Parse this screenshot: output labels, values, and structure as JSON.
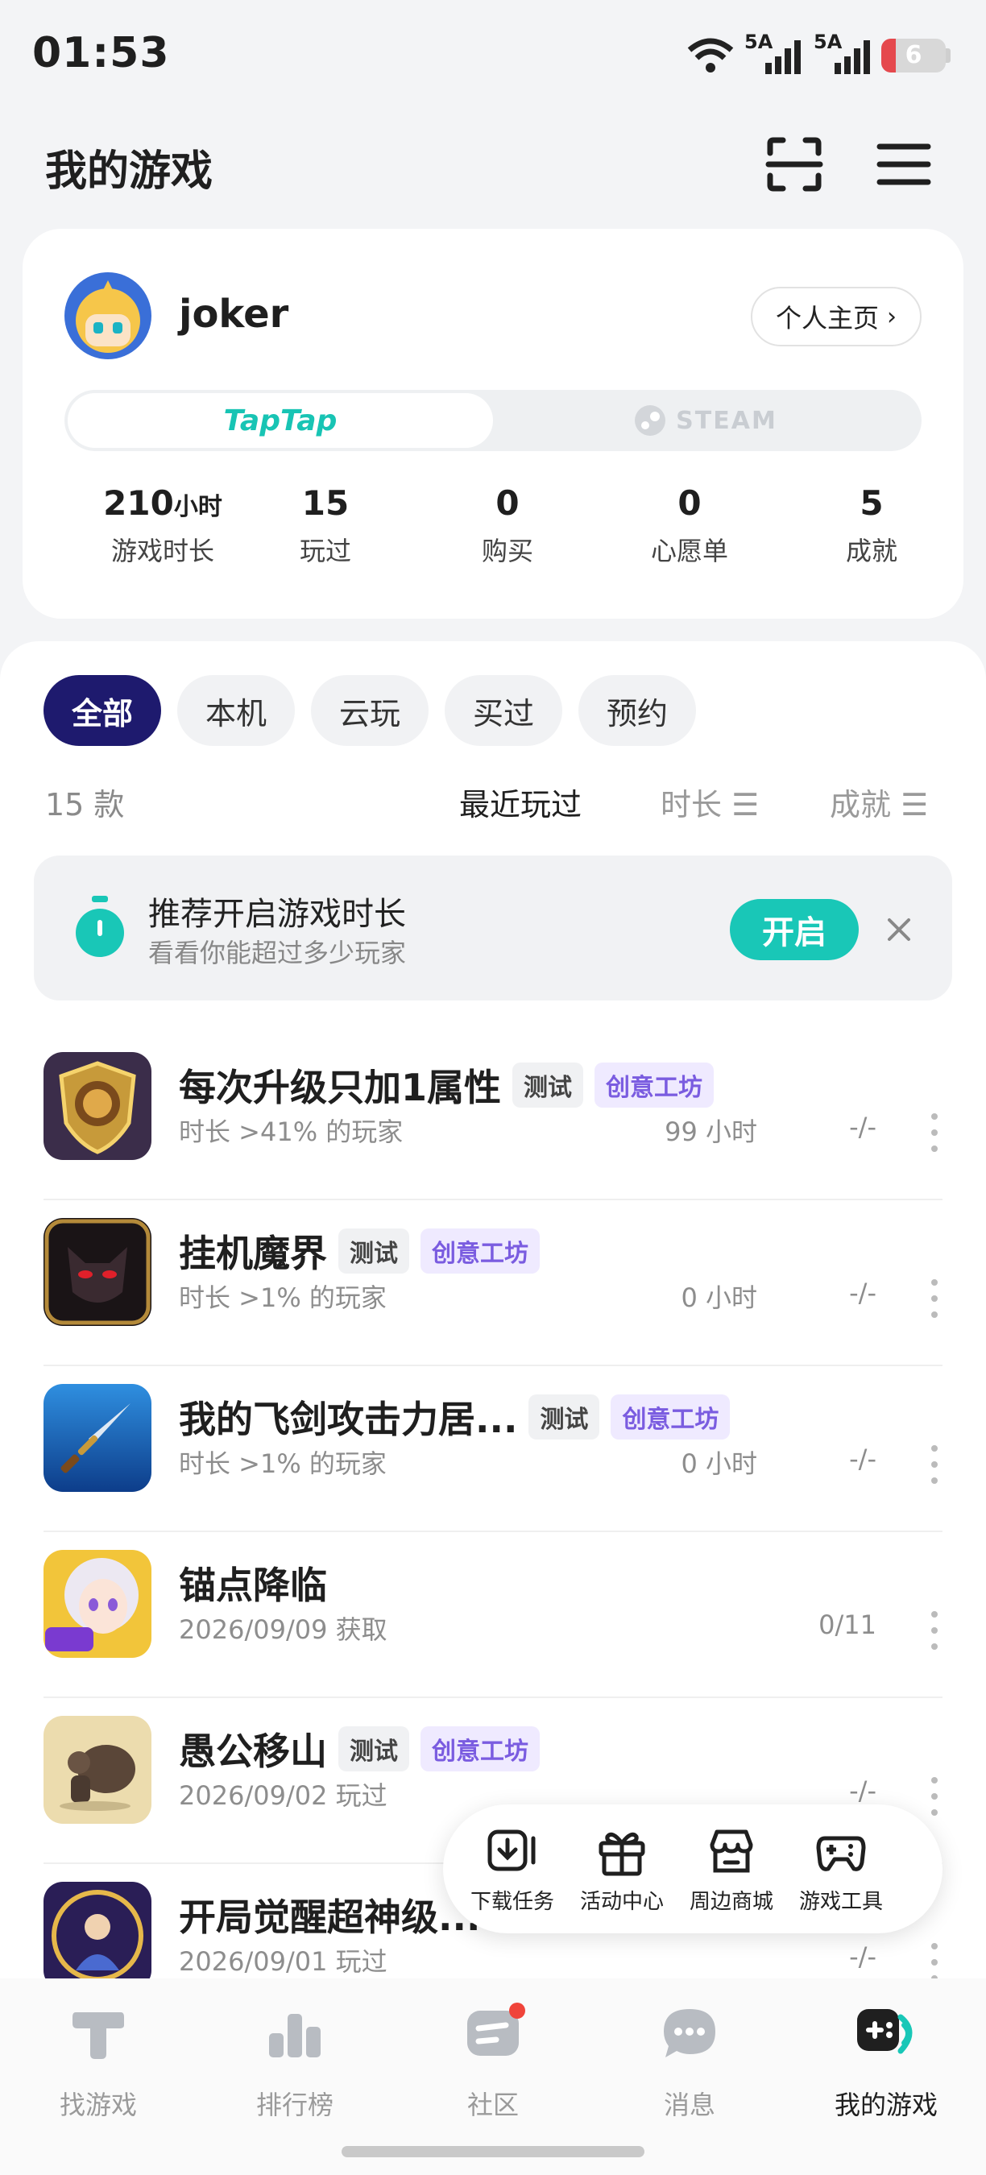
{
  "status_bar": {
    "time": "01:53",
    "sim1": "5A",
    "sim2": "5A",
    "battery": "6"
  },
  "header": {
    "title": "我的游戏",
    "scan_icon": "scan-icon",
    "menu_icon": "menu-icon"
  },
  "profile": {
    "username": "joker",
    "homepage_label": "个人主页",
    "platforms": {
      "taptap": "TapTap",
      "steam": "STEAM",
      "active": "taptap"
    },
    "stats": [
      {
        "value": "210",
        "unit": "小时",
        "label": "游戏时长"
      },
      {
        "value": "15",
        "unit": "",
        "label": "玩过"
      },
      {
        "value": "0",
        "unit": "",
        "label": "购买"
      },
      {
        "value": "0",
        "unit": "",
        "label": "心愿单"
      },
      {
        "value": "5",
        "unit": "",
        "label": "成就"
      }
    ]
  },
  "filters": {
    "items": [
      "全部",
      "本机",
      "云玩",
      "买过",
      "预约"
    ],
    "active": "全部"
  },
  "list_meta": {
    "count": "15 款",
    "sorts": [
      {
        "label": "最近玩过",
        "active": true
      },
      {
        "label": "时长 ☰",
        "active": false
      },
      {
        "label": "成就 ☰",
        "active": false
      }
    ]
  },
  "banner": {
    "title": "推荐开启游戏时长",
    "subtitle": "看看你能超过多少玩家",
    "button": "开启"
  },
  "games": [
    {
      "name": "每次升级只加1属性",
      "tags": [
        "测试",
        "创意工坊"
      ],
      "sub": "时长 >41% 的玩家",
      "hours": "99 小时",
      "ach": "-/-"
    },
    {
      "name": "挂机魔界",
      "tags": [
        "测试",
        "创意工坊"
      ],
      "sub": "时长 >1% 的玩家",
      "hours": "0 小时",
      "ach": "-/-"
    },
    {
      "name": "我的飞剑攻击力居...",
      "tags": [
        "测试",
        "创意工坊"
      ],
      "sub": "时长 >1% 的玩家",
      "hours": "0 小时",
      "ach": "-/-"
    },
    {
      "name": "锚点降临",
      "tags": [],
      "sub": "2026/09/09 获取",
      "hours": "",
      "ach": "0/11"
    },
    {
      "name": "愚公移山",
      "tags": [
        "测试",
        "创意工坊"
      ],
      "sub": "2026/09/02 玩过",
      "hours": "",
      "ach": "-/-"
    },
    {
      "name": "开局觉醒超神级...",
      "tags": [],
      "sub": "2026/09/01 玩过",
      "hours": "",
      "ach": "-/-"
    }
  ],
  "floating_tools": [
    {
      "label": "下载任务",
      "icon": "download-icon"
    },
    {
      "label": "活动中心",
      "icon": "gift-icon"
    },
    {
      "label": "周边商城",
      "icon": "store-icon"
    },
    {
      "label": "游戏工具",
      "icon": "gamepad-icon"
    }
  ],
  "bottom_nav": [
    {
      "label": "找游戏",
      "icon": "taptap-t-icon",
      "active": false
    },
    {
      "label": "排行榜",
      "icon": "ranking-icon",
      "active": false
    },
    {
      "label": "社区",
      "icon": "community-icon",
      "active": false,
      "badge": true
    },
    {
      "label": "消息",
      "icon": "message-icon",
      "active": false
    },
    {
      "label": "我的游戏",
      "icon": "my-games-icon",
      "active": true
    }
  ],
  "colors": {
    "accent": "#19c7b7",
    "active_filter": "#1e1a6e",
    "workshop_tag": "#7a5ce0"
  }
}
